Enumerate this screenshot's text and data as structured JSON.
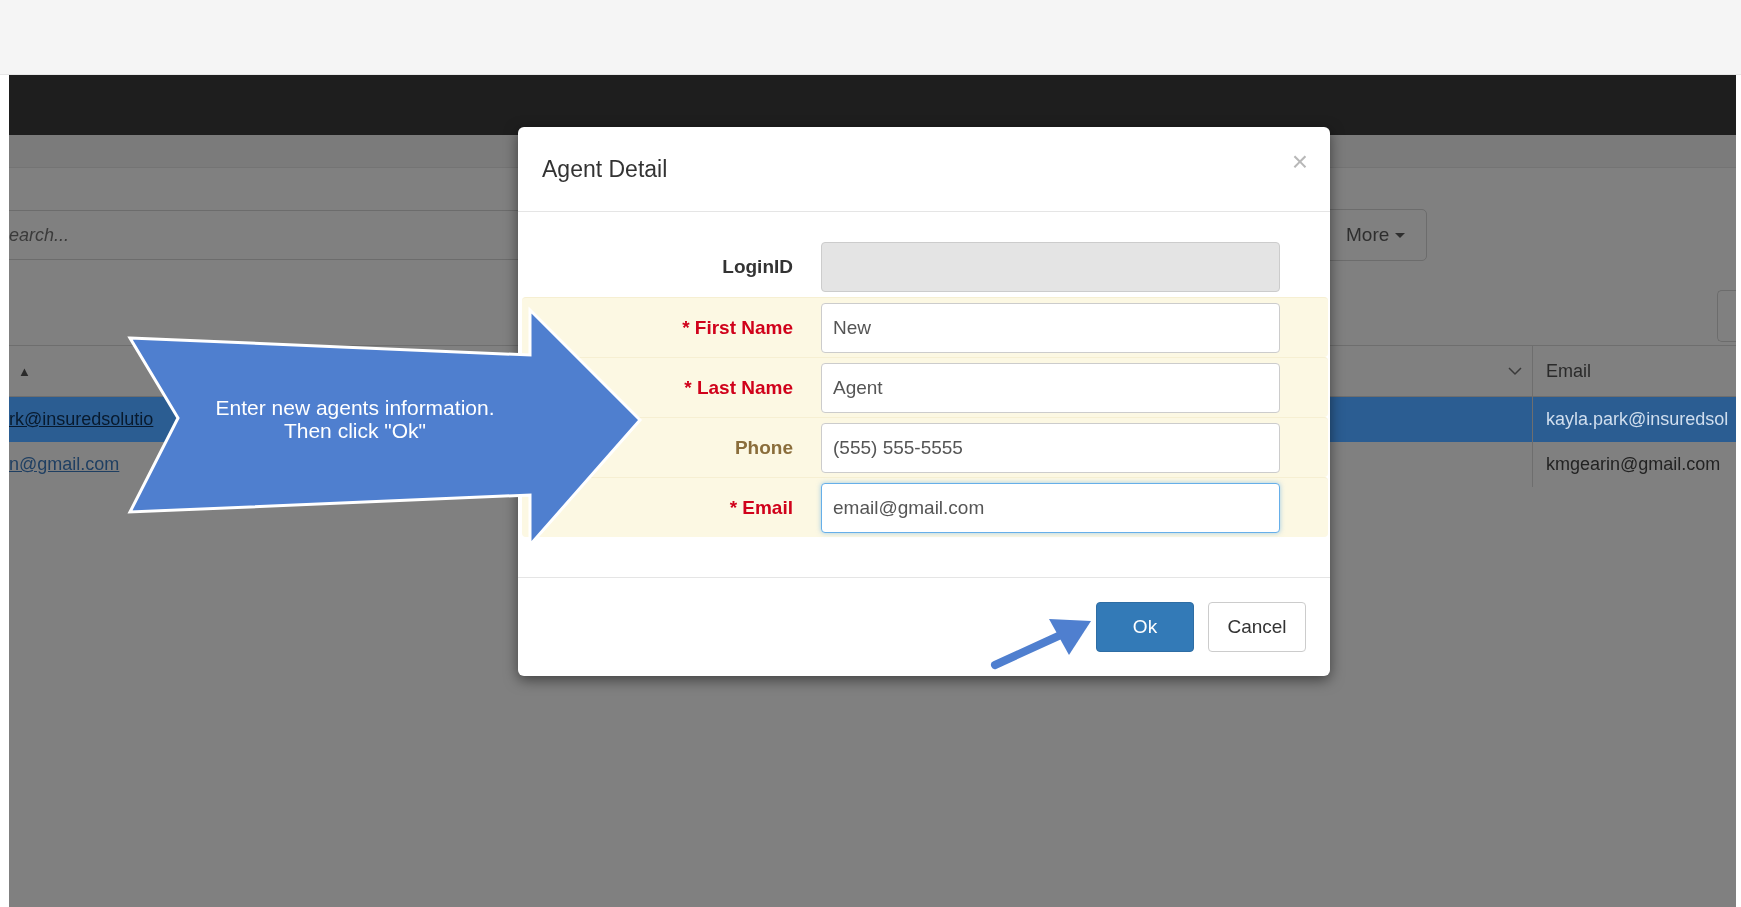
{
  "page": {
    "search": {
      "placeholder": "earch..."
    },
    "more_button": {
      "label": "More",
      "caret": true
    },
    "table": {
      "columns": [
        {
          "sort_indicator": "▲"
        },
        {
          "has_menu": true
        },
        {
          "label": "Email"
        }
      ],
      "rows": [
        {
          "selected": true,
          "cells": [
            "rk@insuredsolutio",
            "kayla.park@insuredsol"
          ]
        },
        {
          "selected": false,
          "cells": [
            "n@gmail.com",
            "kmgearin@gmail.com"
          ]
        }
      ]
    }
  },
  "modal": {
    "title": "Agent Detail",
    "close": "×",
    "fields": [
      {
        "label": "LoginID",
        "required": false,
        "highlighted": false,
        "disabled": true,
        "focused": false
      },
      {
        "label": "* First Name",
        "required": true,
        "highlighted": true,
        "disabled": false,
        "focused": false,
        "value": "New"
      },
      {
        "label": "* Last Name",
        "required": true,
        "highlighted": true,
        "disabled": false,
        "focused": false,
        "value": "Agent"
      },
      {
        "label": "Phone",
        "required": false,
        "highlighted": true,
        "disabled": false,
        "focused": false,
        "value": "(555) 555-5555"
      },
      {
        "label": "* Email",
        "required": true,
        "highlighted": true,
        "disabled": false,
        "focused": true,
        "value": "email@gmail.com"
      }
    ],
    "buttons": [
      {
        "label": "Ok",
        "kind": "primary"
      },
      {
        "label": "Cancel",
        "kind": "default"
      }
    ]
  },
  "callout": {
    "text": "Enter new agents information.\nThen click \"Ok\""
  }
}
